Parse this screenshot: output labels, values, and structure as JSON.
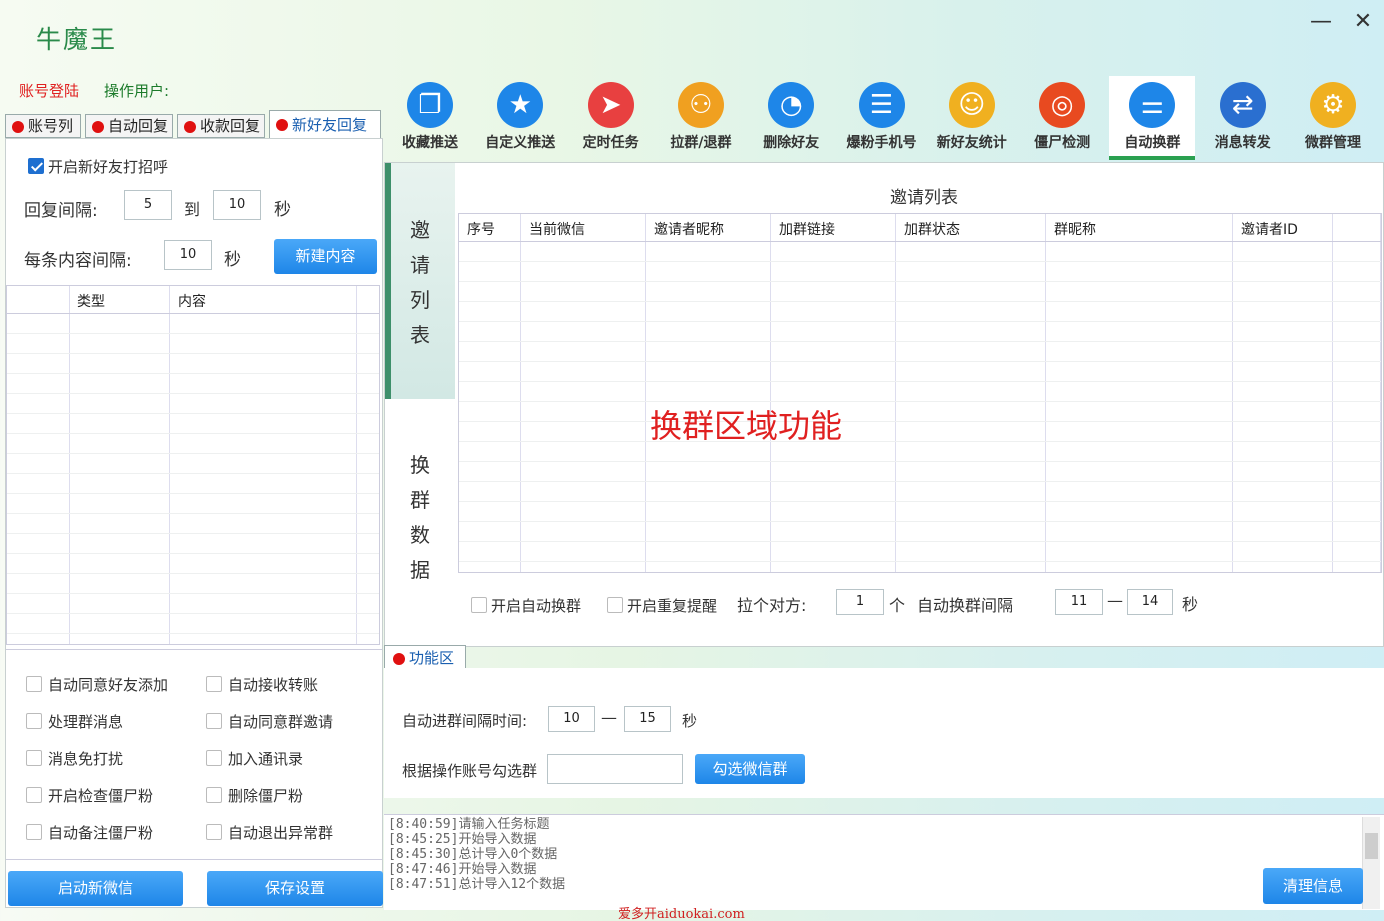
{
  "app": {
    "title": "牛魔王",
    "minimize": "—",
    "close": "✕"
  },
  "account": {
    "login": "账号登陆",
    "operator": "操作用户:"
  },
  "left_tabs": [
    {
      "label": "账号列"
    },
    {
      "label": "自动回复"
    },
    {
      "label": "收款回复"
    },
    {
      "label": "新好友回复"
    }
  ],
  "greeting": {
    "enable_label": "开启新好友打招呼",
    "interval_label": "回复间隔:",
    "interval_from": "5",
    "to_label": "到",
    "interval_to": "10",
    "sec": "秒",
    "content_interval_label": "每条内容间隔:",
    "content_interval": "10",
    "new_content_btn": "新建内容",
    "grid_headers": [
      "类型",
      "内容"
    ]
  },
  "options": [
    [
      "自动同意好友添加",
      "自动接收转账"
    ],
    [
      "处理群消息",
      "自动同意群邀请"
    ],
    [
      "消息免打扰",
      "加入通讯录"
    ],
    [
      "开启检查僵尸粉",
      "删除僵尸粉"
    ],
    [
      "自动备注僵尸粉",
      "自动退出异常群"
    ]
  ],
  "bottom_buttons": {
    "start": "启动新微信",
    "save": "保存设置"
  },
  "toolbar": [
    {
      "label": "收藏推送",
      "icon": "favorite-push-icon"
    },
    {
      "label": "自定义推送",
      "icon": "custom-push-icon"
    },
    {
      "label": "定时任务",
      "icon": "scheduled-task-icon"
    },
    {
      "label": "拉群/退群",
      "icon": "group-join-icon"
    },
    {
      "label": "删除好友",
      "icon": "delete-friend-icon"
    },
    {
      "label": "爆粉手机号",
      "icon": "phone-list-icon"
    },
    {
      "label": "新好友统计",
      "icon": "user-stats-icon"
    },
    {
      "label": "僵尸检测",
      "icon": "target-icon"
    },
    {
      "label": "自动换群",
      "icon": "sliders-icon"
    },
    {
      "label": "消息转发",
      "icon": "forward-icon"
    },
    {
      "label": "微群管理",
      "icon": "gear-icon"
    }
  ],
  "side_tabs": {
    "invite": [
      "邀",
      "请",
      "列",
      "表"
    ],
    "swap": [
      "换",
      "群",
      "数",
      "据"
    ]
  },
  "invite_list": {
    "title": "邀请列表",
    "headers": [
      "序号",
      "当前微信",
      "邀请者昵称",
      "加群链接",
      "加群状态",
      "群昵称",
      "邀请者ID"
    ],
    "watermark": "换群区域功能"
  },
  "swap_settings": {
    "auto_swap": "开启自动换群",
    "repeat_remind": "开启重复提醒",
    "pull_label": "拉个对方:",
    "pull_value": "1",
    "unit": "个",
    "interval_label": "自动换群间隔",
    "interval_from": "11",
    "dash": "—",
    "interval_to": "14",
    "sec": "秒"
  },
  "func_tab": {
    "label": "功能区"
  },
  "func": {
    "enter_interval_label": "自动进群间隔时间:",
    "enter_from": "10",
    "dash": "—",
    "enter_to": "15",
    "sec": "秒",
    "select_label": "根据操作账号勾选群",
    "select_value": "",
    "select_btn": "勾选微信群"
  },
  "log": {
    "lines": [
      "[8:40:59]请输入任务标题",
      "[8:45:25]开始导入数据",
      "[8:45:30]总计导入0个数据",
      "[8:47:46]开始导入数据",
      "[8:47:51]总计导入12个数据"
    ],
    "clear_btn": "清理信息"
  },
  "watermark": "爱多开aiduokai.com",
  "colors": {
    "accent": "#1e86e8",
    "brand_green": "#2a8a4a",
    "alert_red": "#e02020"
  }
}
